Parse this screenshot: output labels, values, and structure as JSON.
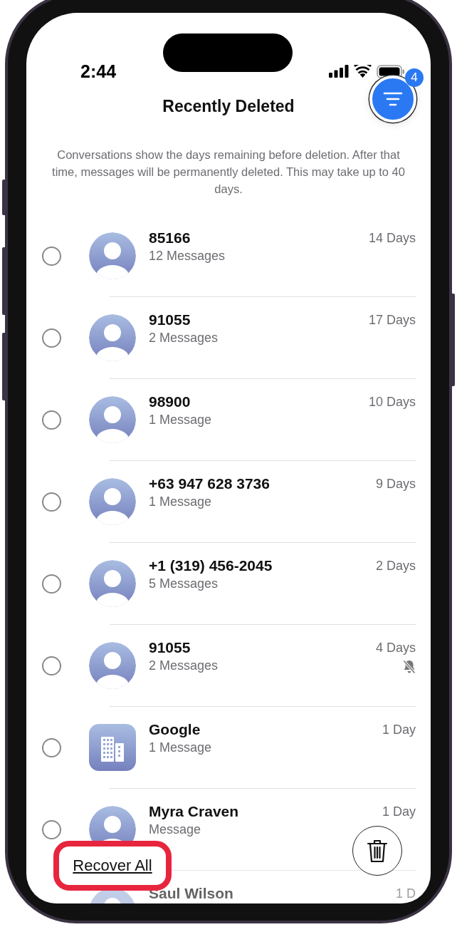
{
  "status_bar": {
    "time": "2:44"
  },
  "header": {
    "title": "Recently Deleted",
    "filter_badge": "4"
  },
  "description": "Conversations show the days remaining before deletion. After that time, messages will be permanently deleted. This may take up to 40 days.",
  "conversations": [
    {
      "kind": "person",
      "name": "85166",
      "subtitle": "12 Messages",
      "remaining": "14 Days",
      "muted": false,
      "selected": false
    },
    {
      "kind": "person",
      "name": "91055",
      "subtitle": "2 Messages",
      "remaining": "17 Days",
      "muted": false,
      "selected": false
    },
    {
      "kind": "person",
      "name": "98900",
      "subtitle": "1 Message",
      "remaining": "10 Days",
      "muted": false,
      "selected": false
    },
    {
      "kind": "person",
      "name": "+63 947 628 3736",
      "subtitle": "1 Message",
      "remaining": "9 Days",
      "muted": false,
      "selected": false
    },
    {
      "kind": "person",
      "name": "+1 (319) 456-2045",
      "subtitle": "5 Messages",
      "remaining": "2 Days",
      "muted": false,
      "selected": false
    },
    {
      "kind": "person",
      "name": "91055",
      "subtitle": "2 Messages",
      "remaining": "4 Days",
      "muted": true,
      "selected": false
    },
    {
      "kind": "business",
      "name": "Google",
      "subtitle": "1 Message",
      "remaining": "1 Day",
      "muted": false,
      "selected": false
    },
    {
      "kind": "person",
      "name": "Myra Craven",
      "subtitle": "Message",
      "remaining": "1 Day",
      "muted": false,
      "selected": false
    },
    {
      "kind": "person",
      "name": "Saul Wilson",
      "remaining": "1 D"
    }
  ],
  "actions": {
    "recover_all": "Recover All"
  }
}
